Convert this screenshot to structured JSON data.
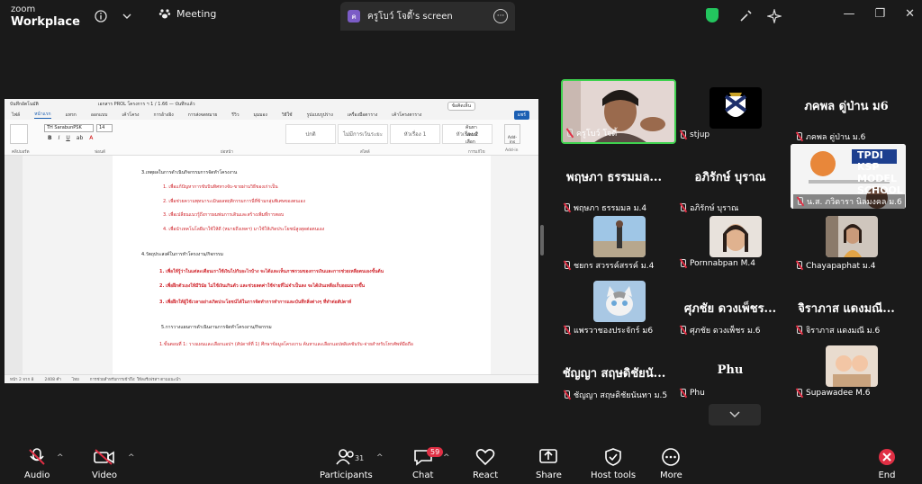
{
  "app": {
    "brand_line1": "zoom",
    "brand_line2": "Workplace",
    "meeting_label": "Meeting",
    "shared_screen_title": "ครูโบว์ โจดี้'s screen",
    "shared_screen_initial": "ค"
  },
  "shared_doc": {
    "title_bar": {
      "autosave": "บันทึกอัตโนมัติ",
      "file_name": "เอกสาร PROL โครงการ ฯ 1 / 1.66 — บันทึกแล้ว",
      "comment_label": "ข้อคิดเห็น"
    },
    "menu": [
      "ไฟล์",
      "หน้าแรก",
      "แทรก",
      "ออกแบบ",
      "เค้าโครง",
      "การอ้างอิง",
      "การส่งจดหมาย",
      "รีวิว",
      "มุมมอง",
      "วิธีใช้",
      "รูปแบบรูปร่าง",
      "เครื่องมือตาราง",
      "เค้าโครงตาราง"
    ],
    "share_label": "แชร์",
    "font_name": "TH SarabunPSK",
    "font_size": "14",
    "styles": [
      "ปกติ",
      "ไม่มีการเว้นระยะ",
      "หัวเรื่อง 1",
      "หัวเรื่อง 2"
    ],
    "side_tools": [
      "ค้นหา",
      "แทนที่",
      "เลือก"
    ],
    "addin_label": "Add-ins",
    "group_labels": [
      "คลิปบอร์ด",
      "ฟอนต์",
      "ย่อหน้า",
      "สไตล์",
      "การแก้ไข",
      "Add-in"
    ],
    "lines": [
      {
        "text": "3.เหตุผลในการดำเนินกิจกรรมการจัดทำโครงงาน",
        "color": "black"
      },
      {
        "text": "1. เพื่อแก้ปัญหาการขับบินทิศทางจับ-ขายผ่านวิธีของเก่าเป็น",
        "color": "red"
      },
      {
        "text": "2. เพื่อช่วยความพุทนาระเมินผลพฤติกรรมการนี่ที่ข้ามกลุ่มพิเศษของตนเอง",
        "color": "red"
      },
      {
        "text": "3. เพื่อเปลี่ยนแนวรู้ถึงการผมพ่นการเดินและสร้างเพิ่มที่การตอบ",
        "color": "red"
      },
      {
        "text": "4. เพื่อนำเทคโนโลยีมาใช้ให้ดี (หมายถึงเทคฯ) มาใช้ให้เกิดประโยชน์สูงสุดต่อตนเอง",
        "color": "red"
      },
      {
        "text": "4.วัตถุประสงค์ในการทำโครงงาน/กิจกรรม",
        "color": "black"
      },
      {
        "text": "1. เพื่อให้รู้ว่าในแต่ละเดือนเราใช้เงินไปกับอะไรบ้าง จะได้และเห็นภาพรวมของการเงินและการช่วยเหลือตนเองขั้นต้น",
        "color": "red",
        "bold": true
      },
      {
        "text": "2. เพื่อฝึกตัวเองให้มีวินัย ไม่ใช้เงินเกินตัว และช่วยลดค่าใช้จ่ายที่ไม่จำเป็นลง จะได้เงินเหลือเก็บออมมากขึ้น",
        "color": "red",
        "bold": true
      },
      {
        "text": "3. เพื่อฝึกให้ผู้ใช้เวลาอย่างเกิดประโยชน์ได้ในการจัดทำการทำการและบันทึกสิ่งต่างๆ ที่ทำต่อสัปดาห์",
        "color": "red",
        "bold": true
      },
      {
        "text": "5.การวางแผนการดำเนินงานการจัดทำโครงงาน/กิจกรรม",
        "color": "black"
      },
      {
        "text": "1.ขั้นตอนที่ 1: วางแผนและเลือกแอปฯ (สัปดาห์ที่ 1) ศึกษาข้อมูลโครงงาน ค้นหาและเลือกแอปพลิเคชันรับ-จ่ายสำหรับโทรศัพท์มือถือ",
        "color": "red"
      }
    ],
    "status": [
      "หน้า 2 จาก 8",
      "2408 คำ",
      "ไทย",
      "การช่วยสำหรับการเข้าถึง: ให้ลงรีเฟรสฯ ตามแนะนำ"
    ]
  },
  "participants": [
    {
      "name": "ครูโบว์ โจดี้",
      "display": "video",
      "active_speaker": true
    },
    {
      "name": "stjup",
      "display": "logo"
    },
    {
      "name": "ภคพล ดู่ป่าน ม.6",
      "big_name": "ภคพล ดู่ป่าน ม6"
    },
    {
      "name": "พฤษภา ธรรมมล ม.4",
      "big_name": "พฤษภา ธรรมมล..."
    },
    {
      "name": "อภิรักษ์ บุราณ",
      "big_name": "อภิรักษ์ บุราณ"
    },
    {
      "name": "น.ส. ภวิดารา นิลมงคล ม.6",
      "display": "video",
      "video_text": "TPDI KSP MODEL SCHOOL"
    },
    {
      "name": "ชยกร สวรรค์สรรค์ ม.4",
      "display": "video"
    },
    {
      "name": "Pornnabpan M.4",
      "display": "video"
    },
    {
      "name": "Chayapaphat ม.4",
      "display": "video"
    },
    {
      "name": "แพรวาชองประจักร์ ม6",
      "display": "video"
    },
    {
      "name": "ศุภชัย ดวงเพ็ชร ม.6",
      "big_name": "ศุภชัย ดวงเพ็ชร..."
    },
    {
      "name": "จิราภาส แดงมณี ม.6",
      "big_name": "จิราภาส แดงมณี..."
    },
    {
      "name": "ชัญญา สฤษดิชัยนันทา ม.5",
      "big_name": "ชัญญา สฤษดิชัยนั..."
    },
    {
      "name": "Phu",
      "big_name": "Phu"
    },
    {
      "name": "Supawadee M.6",
      "display": "video"
    }
  ],
  "toolbar": {
    "audio": "Audio",
    "video": "Video",
    "participants": "Participants",
    "participants_count": "31",
    "chat": "Chat",
    "chat_badge": "59",
    "react": "React",
    "share": "Share",
    "host_tools": "Host tools",
    "more": "More",
    "end": "End"
  },
  "colors": {
    "bg": "#1a1a1a",
    "active_border": "#3fd14f",
    "mute_red": "#e02f44",
    "end_red": "#e02f44",
    "share_green": "#23c55e"
  },
  "icons": [
    "info-icon",
    "chevron-down-icon",
    "paw-icon",
    "shield-icon",
    "brush-icon",
    "sparkle-icon",
    "minimize-icon",
    "restore-icon",
    "close-icon",
    "mic-muted-icon",
    "video-off-icon",
    "participants-icon",
    "chat-icon",
    "heart-icon",
    "share-icon",
    "host-tools-icon",
    "more-icon",
    "end-icon"
  ]
}
